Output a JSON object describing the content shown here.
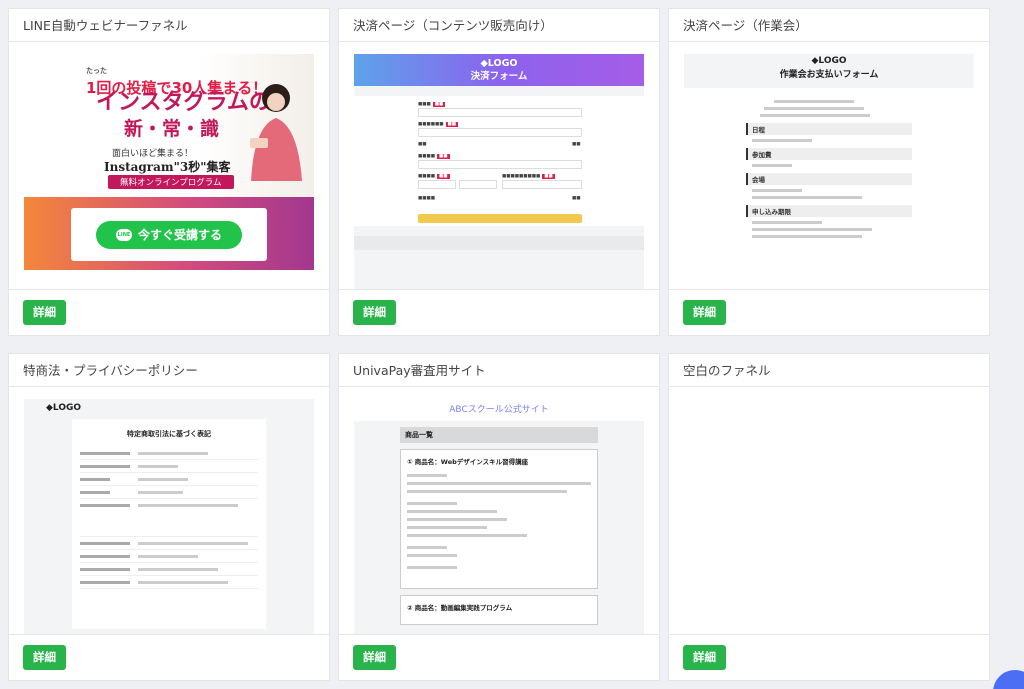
{
  "detail_label": "詳細",
  "cards": [
    {
      "title": "LINE自動ウェビナーファネル",
      "preview": {
        "l1_pre": "たった",
        "l1_main": "1回の投稿で30人集まる！",
        "l2": "インスタグラムの",
        "l3": "新・常・識",
        "l4": "面白いほど集まる！",
        "l5": "Instagram\"3秒\"集客",
        "l6": "無料オンラインプログラム",
        "line_icon_text": "LINE",
        "cta": "今すぐ受講する"
      }
    },
    {
      "title": "決済ページ（コンテンツ販売向け）",
      "preview": {
        "logo": "◆LOGO",
        "heading": "決済フォーム"
      }
    },
    {
      "title": "決済ページ（作業会）",
      "preview": {
        "logo": "◆LOGO",
        "heading": "作業会お支払いフォーム",
        "sections": [
          "日程",
          "参加費",
          "会場",
          "申し込み期限"
        ]
      }
    },
    {
      "title": "特商法・プライバシーポリシー",
      "preview": {
        "logo": "◆LOGO",
        "heading": "特定商取引法に基づく表記"
      }
    },
    {
      "title": "UnivaPay審査用サイト",
      "preview": {
        "site_title": "ABCスクール公式サイト",
        "list_title": "商品一覧",
        "item1": "① 商品名：Webデザインスキル習得講座",
        "item2": "② 商品名：動画編集実践プログラム"
      }
    },
    {
      "title": "空白のファネル",
      "preview": {}
    }
  ],
  "colors": {
    "detail_button": "#28b44b",
    "line_green": "#22c34b",
    "accent_pink": "#c2185b",
    "fab_blue": "#4c6ef5"
  }
}
